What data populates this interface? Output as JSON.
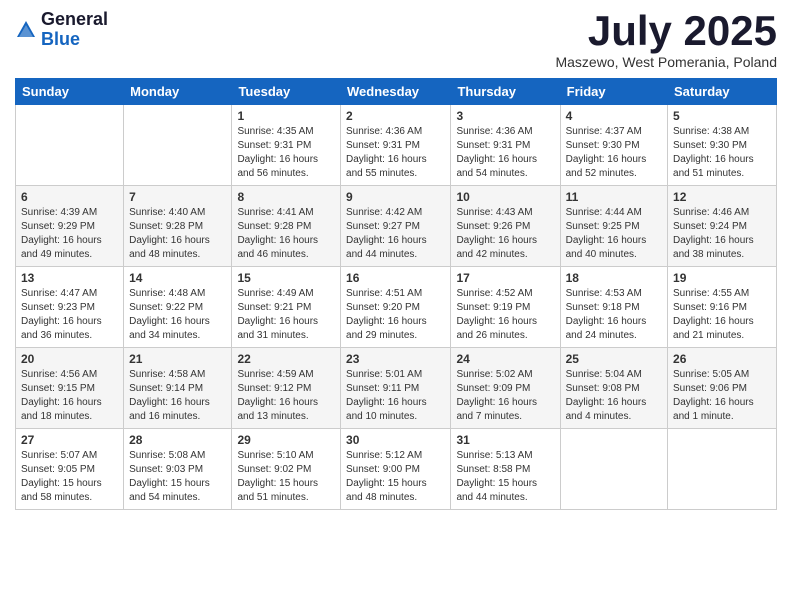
{
  "logo": {
    "general": "General",
    "blue": "Blue"
  },
  "title": "July 2025",
  "location": "Maszewo, West Pomerania, Poland",
  "days_of_week": [
    "Sunday",
    "Monday",
    "Tuesday",
    "Wednesday",
    "Thursday",
    "Friday",
    "Saturday"
  ],
  "weeks": [
    [
      {
        "day": "",
        "info": ""
      },
      {
        "day": "",
        "info": ""
      },
      {
        "day": "1",
        "info": "Sunrise: 4:35 AM\nSunset: 9:31 PM\nDaylight: 16 hours and 56 minutes."
      },
      {
        "day": "2",
        "info": "Sunrise: 4:36 AM\nSunset: 9:31 PM\nDaylight: 16 hours and 55 minutes."
      },
      {
        "day": "3",
        "info": "Sunrise: 4:36 AM\nSunset: 9:31 PM\nDaylight: 16 hours and 54 minutes."
      },
      {
        "day": "4",
        "info": "Sunrise: 4:37 AM\nSunset: 9:30 PM\nDaylight: 16 hours and 52 minutes."
      },
      {
        "day": "5",
        "info": "Sunrise: 4:38 AM\nSunset: 9:30 PM\nDaylight: 16 hours and 51 minutes."
      }
    ],
    [
      {
        "day": "6",
        "info": "Sunrise: 4:39 AM\nSunset: 9:29 PM\nDaylight: 16 hours and 49 minutes."
      },
      {
        "day": "7",
        "info": "Sunrise: 4:40 AM\nSunset: 9:28 PM\nDaylight: 16 hours and 48 minutes."
      },
      {
        "day": "8",
        "info": "Sunrise: 4:41 AM\nSunset: 9:28 PM\nDaylight: 16 hours and 46 minutes."
      },
      {
        "day": "9",
        "info": "Sunrise: 4:42 AM\nSunset: 9:27 PM\nDaylight: 16 hours and 44 minutes."
      },
      {
        "day": "10",
        "info": "Sunrise: 4:43 AM\nSunset: 9:26 PM\nDaylight: 16 hours and 42 minutes."
      },
      {
        "day": "11",
        "info": "Sunrise: 4:44 AM\nSunset: 9:25 PM\nDaylight: 16 hours and 40 minutes."
      },
      {
        "day": "12",
        "info": "Sunrise: 4:46 AM\nSunset: 9:24 PM\nDaylight: 16 hours and 38 minutes."
      }
    ],
    [
      {
        "day": "13",
        "info": "Sunrise: 4:47 AM\nSunset: 9:23 PM\nDaylight: 16 hours and 36 minutes."
      },
      {
        "day": "14",
        "info": "Sunrise: 4:48 AM\nSunset: 9:22 PM\nDaylight: 16 hours and 34 minutes."
      },
      {
        "day": "15",
        "info": "Sunrise: 4:49 AM\nSunset: 9:21 PM\nDaylight: 16 hours and 31 minutes."
      },
      {
        "day": "16",
        "info": "Sunrise: 4:51 AM\nSunset: 9:20 PM\nDaylight: 16 hours and 29 minutes."
      },
      {
        "day": "17",
        "info": "Sunrise: 4:52 AM\nSunset: 9:19 PM\nDaylight: 16 hours and 26 minutes."
      },
      {
        "day": "18",
        "info": "Sunrise: 4:53 AM\nSunset: 9:18 PM\nDaylight: 16 hours and 24 minutes."
      },
      {
        "day": "19",
        "info": "Sunrise: 4:55 AM\nSunset: 9:16 PM\nDaylight: 16 hours and 21 minutes."
      }
    ],
    [
      {
        "day": "20",
        "info": "Sunrise: 4:56 AM\nSunset: 9:15 PM\nDaylight: 16 hours and 18 minutes."
      },
      {
        "day": "21",
        "info": "Sunrise: 4:58 AM\nSunset: 9:14 PM\nDaylight: 16 hours and 16 minutes."
      },
      {
        "day": "22",
        "info": "Sunrise: 4:59 AM\nSunset: 9:12 PM\nDaylight: 16 hours and 13 minutes."
      },
      {
        "day": "23",
        "info": "Sunrise: 5:01 AM\nSunset: 9:11 PM\nDaylight: 16 hours and 10 minutes."
      },
      {
        "day": "24",
        "info": "Sunrise: 5:02 AM\nSunset: 9:09 PM\nDaylight: 16 hours and 7 minutes."
      },
      {
        "day": "25",
        "info": "Sunrise: 5:04 AM\nSunset: 9:08 PM\nDaylight: 16 hours and 4 minutes."
      },
      {
        "day": "26",
        "info": "Sunrise: 5:05 AM\nSunset: 9:06 PM\nDaylight: 16 hours and 1 minute."
      }
    ],
    [
      {
        "day": "27",
        "info": "Sunrise: 5:07 AM\nSunset: 9:05 PM\nDaylight: 15 hours and 58 minutes."
      },
      {
        "day": "28",
        "info": "Sunrise: 5:08 AM\nSunset: 9:03 PM\nDaylight: 15 hours and 54 minutes."
      },
      {
        "day": "29",
        "info": "Sunrise: 5:10 AM\nSunset: 9:02 PM\nDaylight: 15 hours and 51 minutes."
      },
      {
        "day": "30",
        "info": "Sunrise: 5:12 AM\nSunset: 9:00 PM\nDaylight: 15 hours and 48 minutes."
      },
      {
        "day": "31",
        "info": "Sunrise: 5:13 AM\nSunset: 8:58 PM\nDaylight: 15 hours and 44 minutes."
      },
      {
        "day": "",
        "info": ""
      },
      {
        "day": "",
        "info": ""
      }
    ]
  ]
}
